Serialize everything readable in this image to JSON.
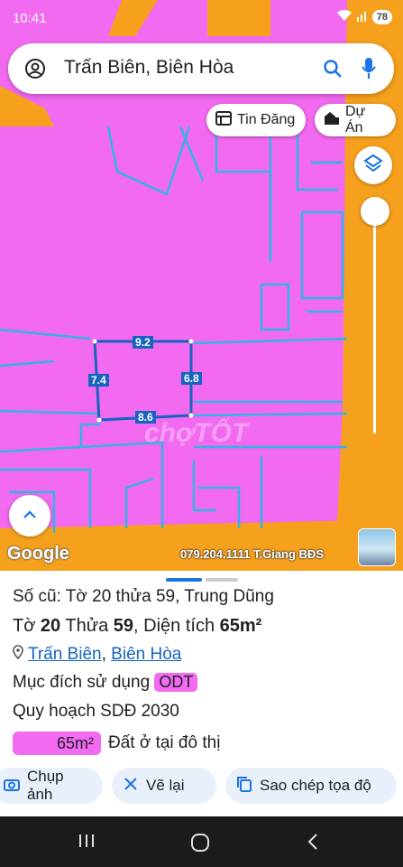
{
  "status": {
    "time": "10:41",
    "battery": "78"
  },
  "search": {
    "value": "Trấn Biên, Biên Hòa"
  },
  "chips": {
    "listings": "Tin Đăng",
    "projects": "Dự Án"
  },
  "parcel": {
    "top": "9.2",
    "left": "7.4",
    "right": "6.8",
    "bottom": "8.6"
  },
  "map": {
    "watermark": "chợTỐT",
    "google": "Google",
    "attribution": "079.204.1111 T.Giang BĐS"
  },
  "info": {
    "old": "Số cũ: Tờ 20 thửa 59, Trung Dũng",
    "to_label": "Tờ",
    "to_value": "20",
    "thua_label": "Thửa",
    "thua_value": "59",
    "area_label": ", Diện tích",
    "area_value": "65m²",
    "location_1": "Trấn Biên",
    "location_sep": ",",
    "location_2": "Biên Hòa",
    "purpose_label": "Mục đích sử dụng",
    "purpose_code": "ODT",
    "plan": "Quy hoạch SDĐ 2030",
    "plan_area": "65m²",
    "plan_desc": "Đất ở tại đô thị"
  },
  "actions": {
    "capture": "Chụp ảnh",
    "redraw": "Vẽ lại",
    "copy": "Sao chép tọa độ"
  },
  "colors": {
    "residential": "#f26af0",
    "road": "#f6a11d",
    "boundary": "#34b4e4",
    "parcel": "#1565c0"
  }
}
